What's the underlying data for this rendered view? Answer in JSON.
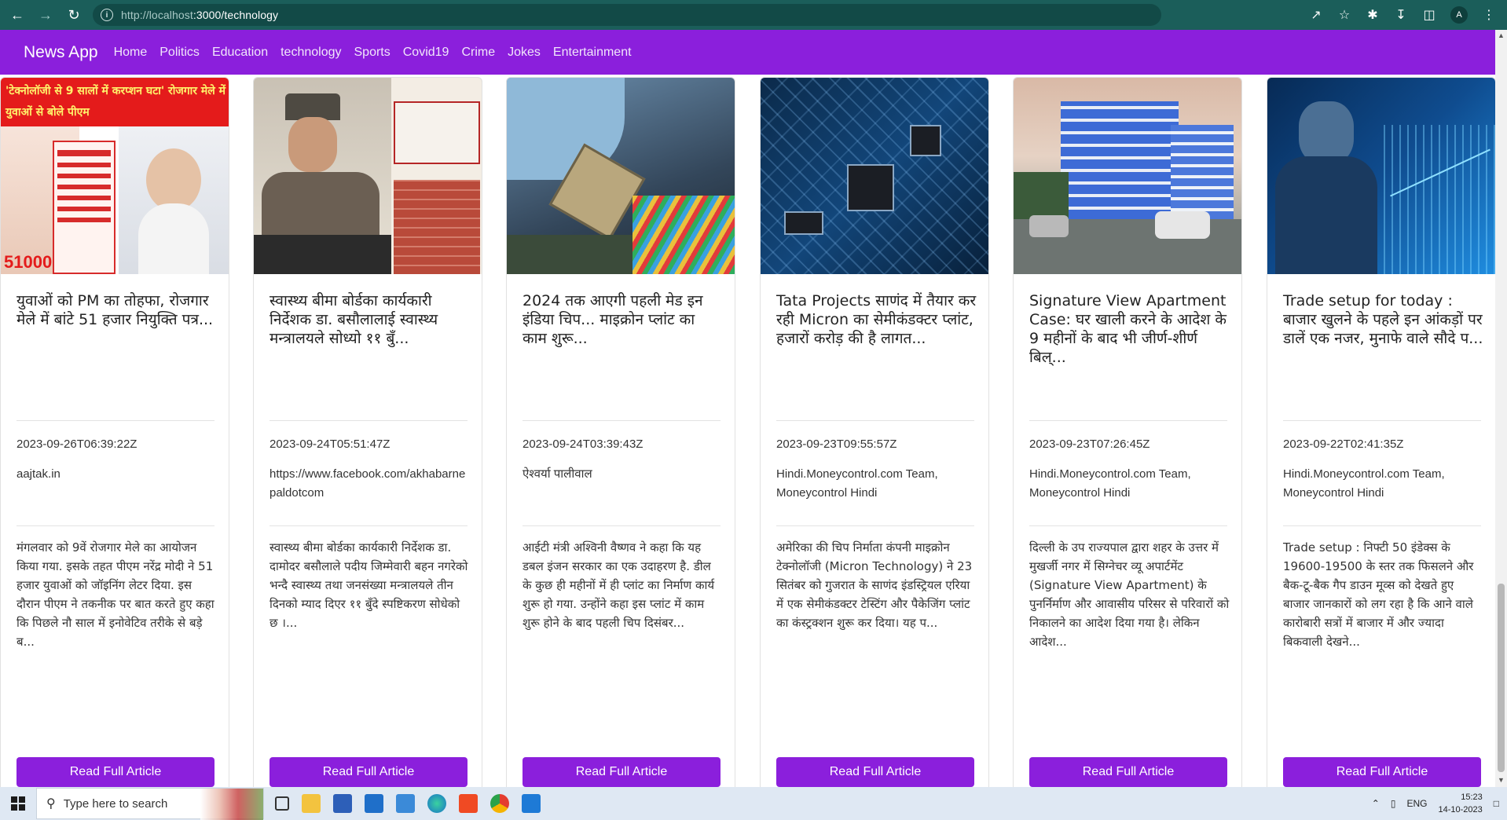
{
  "browser": {
    "url_host": "http://localhost",
    "url_rest": ":3000/technology",
    "profile_initial": "A"
  },
  "navbar": {
    "brand": "News App",
    "links": [
      "Home",
      "Politics",
      "Education",
      "technology",
      "Sports",
      "Covid19",
      "Crime",
      "Jokes",
      "Entertainment"
    ]
  },
  "cards": [
    {
      "title": "युवाओं को PM का तोहफा, रोजगार मेले में बांटे 51 हजार नियुक्ति पत्र...",
      "date": "2023-09-26T06:39:22Z",
      "source": "aajtak.in",
      "description": "मंगलवार को 9वें रोजगार मेले का आयोजन किया गया. इसके तहत पीएम नरेंद्र मोदी ने 51 हजार युवाओं को जॉइनिंग लेटर दिया. इस दौरान पीएम ने तकनीक पर बात करते हुए कहा कि पिछले नौ साल में इनोवेटिव तरीके से बड़े ब...",
      "button": "Read Full Article",
      "image_headline": "'टेक्नोलॉजी से 9 सालों में करप्शन घटा' रोजगार मेले में युवाओं से बोले पीएम",
      "image_number": "51000"
    },
    {
      "title": "स्वास्थ्य बीमा बोर्डका कार्यकारी निर्देशक डा. बसौलालाई स्वास्थ्य मन्त्रालयले सोध्यो ११ बुँ...",
      "date": "2023-09-24T05:51:47Z",
      "source": "https://www.facebook.com/akhabarnepaldotcom",
      "description": "स्वास्थ्य बीमा बोर्डका कार्यकारी निर्देशक डा. दामोदर बसौलाले पदीय जिम्मेवारी बहन नगरेको भन्दै स्वास्थ्य तथा जनसंख्या मन्त्रालयले तीन दिनको म्याद दिएर ११ बुँदे स्पष्टिकरण सोधेको छ ।...",
      "button": "Read Full Article"
    },
    {
      "title": "2024 तक आएगी पहली मेड इन इंडिया चिप... माइक्रोन प्लांट का काम शुरू...",
      "date": "2023-09-24T03:39:43Z",
      "source": "ऐश्वर्या पालीवाल",
      "description": "आईटी मंत्री अश्विनी वैष्णव ने कहा कि यह डबल इंजन सरकार का एक उदाहरण है. डील के कुछ ही महीनों में ही प्लांट का निर्माण कार्य शुरू हो गया. उन्होंने कहा इस प्लांट में काम शुरू होने के बाद पहली चिप दिसंबर...",
      "button": "Read Full Article"
    },
    {
      "title": "Tata Projects साणंद में तैयार कर रही Micron का सेमीकंडक्टर प्लांट, हजारों करोड़ की है लागत...",
      "date": "2023-09-23T09:55:57Z",
      "source": "Hindi.Moneycontrol.com Team, Moneycontrol Hindi",
      "description": "अमेरिका की चिप निर्माता कंपनी माइक्रोन टेक्नोलॉजी (Micron Technology) ने 23 सितंबर को गुजरात के साणंद इंडस्ट्रियल एरिया में एक सेमीकंडक्टर टेस्टिंग और पैकेजिंग प्लांट का कंस्ट्रक्शन शुरू कर दिया। यह प...",
      "button": "Read Full Article"
    },
    {
      "title": "Signature View Apartment Case: घर खाली करने के आदेश के 9 महीनों के बाद भी जीर्ण-शीर्ण बिल्...",
      "date": "2023-09-23T07:26:45Z",
      "source": "Hindi.Moneycontrol.com Team, Moneycontrol Hindi",
      "description": "दिल्ली के उप राज्यपाल द्वारा शहर के उत्तर में मुखर्जी नगर में सिग्नेचर व्यू अपार्टमेंट (Signature View Apartment) के पुनर्निर्माण और आवासीय परिसर से परिवारों को निकालने का आदेश दिया गया है। लेकिन आदेश...",
      "button": "Read Full Article"
    },
    {
      "title": "Trade setup for today : बाजार खुलने के पहले इन आंकड़ों पर डालें एक नजर, मुनाफे वाले सौदे प...",
      "date": "2023-09-22T02:41:35Z",
      "source": "Hindi.Moneycontrol.com Team, Moneycontrol Hindi",
      "description": "Trade setup : निफ्टी 50 इंडेक्स के 19600-19500 के स्तर तक फिसलने और बैक-टू-बैक गैप डाउन मूव्स को देखते हुए बाजार जानकारों को लग रहा है कि आने वाले कारोबारी सत्रों में बाजार में और ज्यादा बिकवाली देखने...",
      "button": "Read Full Article"
    }
  ],
  "taskbar": {
    "search_placeholder": "Type here to search",
    "lang": "ENG",
    "time": "15:23",
    "date": "14-10-2023"
  }
}
